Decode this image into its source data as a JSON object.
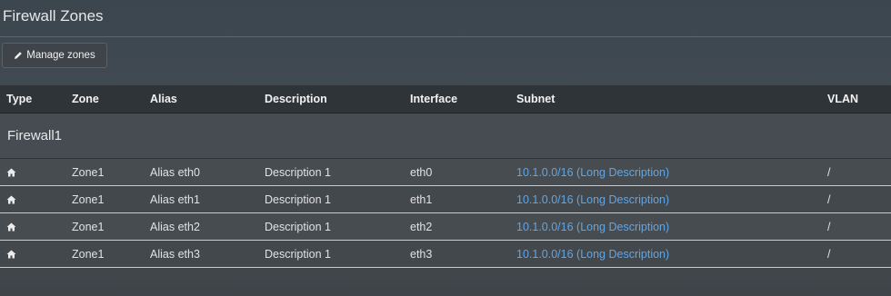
{
  "page": {
    "title": "Firewall Zones"
  },
  "toolbar": {
    "manage_label": "Manage zones",
    "manage_icon": "pencil-icon"
  },
  "table": {
    "headers": {
      "type": "Type",
      "zone": "Zone",
      "alias": "Alias",
      "description": "Description",
      "interface": "Interface",
      "subnet": "Subnet",
      "vlan": "VLAN"
    },
    "group": {
      "label": "Firewall1"
    },
    "rows": [
      {
        "type_icon": "home-icon",
        "zone": "Zone1",
        "alias": "Alias eth0",
        "description": "Description 1",
        "interface": "eth0",
        "subnet": "10.1.0.0/16 (Long Description)",
        "vlan": "/"
      },
      {
        "type_icon": "home-icon",
        "zone": "Zone1",
        "alias": "Alias eth1",
        "description": "Description 1",
        "interface": "eth1",
        "subnet": "10.1.0.0/16 (Long Description)",
        "vlan": "/"
      },
      {
        "type_icon": "home-icon",
        "zone": "Zone1",
        "alias": "Alias eth2",
        "description": "Description 1",
        "interface": "eth2",
        "subnet": "10.1.0.0/16 (Long Description)",
        "vlan": "/"
      },
      {
        "type_icon": "home-icon",
        "zone": "Zone1",
        "alias": "Alias eth3",
        "description": "Description 1",
        "interface": "eth3",
        "subnet": "10.1.0.0/16 (Long Description)",
        "vlan": "/"
      }
    ]
  },
  "colors": {
    "link": "#5fa6e6",
    "header_bg": "#2f3438"
  }
}
